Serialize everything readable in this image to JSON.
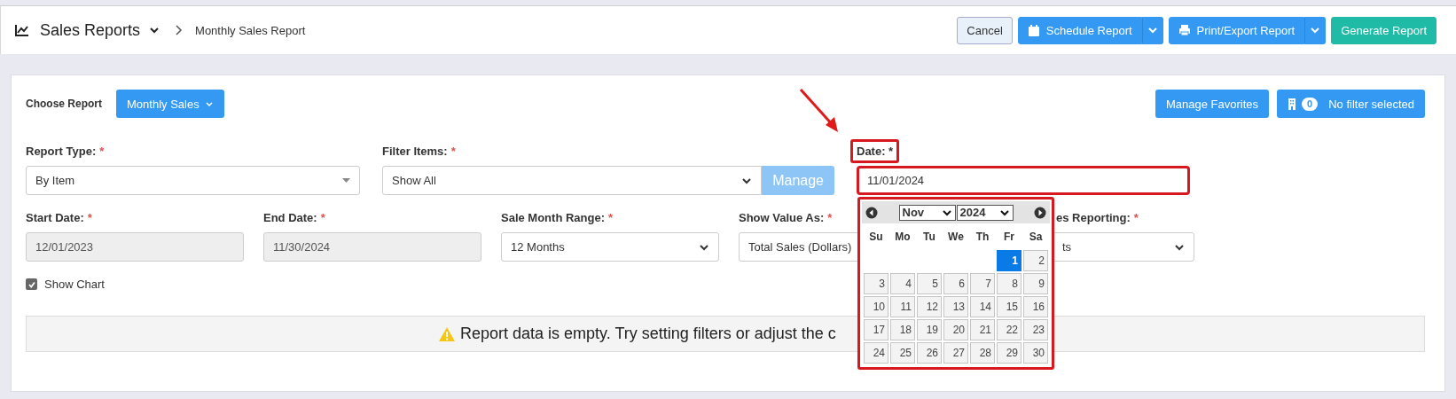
{
  "header": {
    "title": "Sales Reports",
    "breadcrumb": "Monthly Sales Report",
    "buttons": [
      {
        "label": "Cancel",
        "kind": "secondary"
      },
      {
        "label": "Schedule Report",
        "kind": "split"
      },
      {
        "label": "Print/Export Report",
        "kind": "split"
      },
      {
        "label": "Generate Report",
        "kind": "success"
      }
    ]
  },
  "toolbar": {
    "choose_label": "Choose Report",
    "report_dropdown": "Monthly Sales",
    "favorites_button": "Manage Favorites",
    "filter_count": "0",
    "filter_status": "No filter selected"
  },
  "row_1": [
    {
      "label": "Report Type:",
      "mark": "*",
      "kind": "combo",
      "value": "By Item"
    },
    {
      "label": "Filter Items:",
      "mark": "*",
      "kind": "select-button",
      "value": "Show All",
      "button": "Manage",
      "button_disabled": true
    },
    {
      "label": "Date: *",
      "kind": "date",
      "value": "11/01/2024",
      "highlighted": true
    }
  ],
  "row_2": [
    {
      "label": "Start Date:",
      "mark": "*",
      "kind": "readonly",
      "value": "12/01/2023"
    },
    {
      "label": "End Date:",
      "mark": "*",
      "kind": "readonly",
      "value": "11/30/2024"
    },
    {
      "label": "Sale Month Range:",
      "mark": "*",
      "kind": "select",
      "value": "12 Months"
    },
    {
      "label": "Show Value As:",
      "mark": "*",
      "kind": "select",
      "value": "Total Sales (Dollars)"
    },
    {
      "label": "es Reporting:",
      "mark": "*",
      "kind": "select",
      "value": "ts",
      "covered": true
    }
  ],
  "show_chart": {
    "label": "Show Chart",
    "checked": true
  },
  "message": "Report data is empty. Try setting filters or adjust the c",
  "calendar": {
    "month": "Nov",
    "year": "2024",
    "highlighted": true,
    "weekdays": [
      "Su",
      "Mo",
      "Tu",
      "We",
      "Th",
      "Fr",
      "Sa"
    ],
    "weeks": [
      [
        {
          "kind": "blank"
        },
        {
          "kind": "blank"
        },
        {
          "kind": "blank"
        },
        {
          "kind": "blank"
        },
        {
          "kind": "blank"
        },
        {
          "day": "1",
          "selected": true
        },
        {
          "day": "2",
          "selected": false
        }
      ],
      [
        {
          "day": "3",
          "selected": false
        },
        {
          "day": "4",
          "selected": false
        },
        {
          "day": "5",
          "selected": false
        },
        {
          "day": "6",
          "selected": false
        },
        {
          "day": "7",
          "selected": false
        },
        {
          "day": "8",
          "selected": false
        },
        {
          "day": "9",
          "selected": false
        }
      ],
      [
        {
          "day": "10",
          "selected": false
        },
        {
          "day": "11",
          "selected": false
        },
        {
          "day": "12",
          "selected": false
        },
        {
          "day": "13",
          "selected": false
        },
        {
          "day": "14",
          "selected": false
        },
        {
          "day": "15",
          "selected": false
        },
        {
          "day": "16",
          "selected": false
        }
      ],
      [
        {
          "day": "17",
          "selected": false
        },
        {
          "day": "18",
          "selected": false
        },
        {
          "day": "19",
          "selected": false
        },
        {
          "day": "20",
          "selected": false
        },
        {
          "day": "21",
          "selected": false
        },
        {
          "day": "22",
          "selected": false
        },
        {
          "day": "23",
          "selected": false
        }
      ],
      [
        {
          "day": "24",
          "selected": false
        },
        {
          "day": "25",
          "selected": false
        },
        {
          "day": "26",
          "selected": false
        },
        {
          "day": "27",
          "selected": false
        },
        {
          "day": "28",
          "selected": false
        },
        {
          "day": "29",
          "selected": false
        },
        {
          "day": "30",
          "selected": false
        }
      ]
    ]
  }
}
